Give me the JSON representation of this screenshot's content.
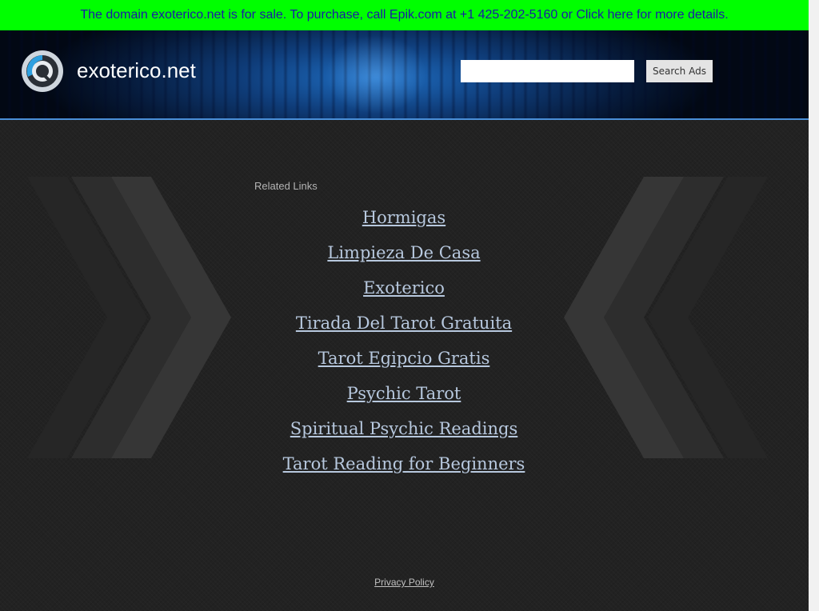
{
  "banner": {
    "text": "The domain exoterico.net is for sale. To purchase, call Epik.com at +1 425-202-5160 or Click here for more details.",
    "background": "#00ff00",
    "text_color": "#1a1aa6"
  },
  "header": {
    "site_name": "exoterico.net",
    "logo_icon": "circular-logo-icon",
    "search": {
      "placeholder": "",
      "value": "",
      "button_label": "Search Ads"
    },
    "accent": "#4a8fd8"
  },
  "main": {
    "related_label": "Related Links",
    "links": [
      "Hormigas",
      "Limpieza De Casa",
      "Exoterico",
      "Tirada Del Tarot Gratuita",
      "Tarot Egipcio Gratis",
      "Psychic Tarot",
      "Spiritual Psychic Readings",
      "Tarot Reading for Beginners"
    ],
    "link_color": "#b7c8de"
  },
  "footer": {
    "privacy_label": "Privacy Policy"
  }
}
